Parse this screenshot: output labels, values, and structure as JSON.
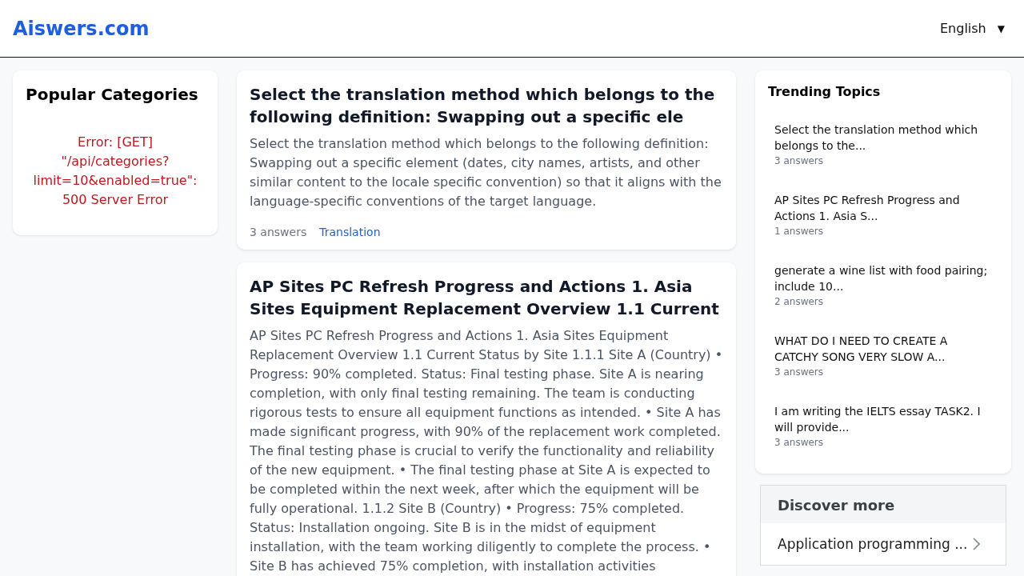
{
  "header": {
    "logo": "Aiswers.com",
    "language": {
      "label": "English",
      "caret": "▼"
    }
  },
  "popular_categories": {
    "title": "Popular Categories",
    "error": "Error: [GET] \"/api/categories?limit=10&enabled=true\": 500 Server Error"
  },
  "questions": [
    {
      "title": "Select the translation method which belongs to the following definition: Swapping out a specific ele",
      "body": "Select the translation method which belongs to the following definition: Swapping out a specific element (dates, city names, artists, and other similar content to the locale specific convention) so that it aligns with the language-specific conventions of the target language.",
      "answers": "3 answers",
      "tag": "Translation"
    },
    {
      "title": "AP Sites PC Refresh Progress and Actions 1. Asia Sites Equipment Replacement Overview 1.1 Current",
      "body": "AP Sites PC Refresh Progress and Actions 1. Asia Sites Equipment Replacement Overview 1.1 Current Status by Site 1.1.1 Site A (Country) • Progress: 90% completed. Status: Final testing phase. Site A is nearing completion, with only final testing remaining. The team is conducting rigorous tests to ensure all equipment functions as intended. • Site A has made significant progress, with 90% of the replacement work completed. The final testing phase is crucial to verify the functionality and reliability of the new equipment. • The final testing phase at Site A is expected to be completed within the next week, after which the equipment will be fully operational. 1.1.2 Site B (Country) • Progress: 75% completed. Status: Installation ongoing. Site B is in the midst of equipment installation, with the team working diligently to complete the process. • Site B has achieved 75% completion, with installation activities"
    }
  ],
  "trending": {
    "title": "Trending Topics",
    "items": [
      {
        "text": "Select the translation method which belongs to the...",
        "answers": "3 answers"
      },
      {
        "text": "AP Sites PC Refresh Progress and Actions 1. Asia S...",
        "answers": "1 answers"
      },
      {
        "text": "generate a wine list with food pairing; include 10...",
        "answers": "2 answers"
      },
      {
        "text": "WHAT DO I NEED TO CREATE A CATCHY SONG VERY SLOW A...",
        "answers": "3 answers"
      },
      {
        "text": "I am writing the IELTS essay TASK2. I will provide...",
        "answers": "3 answers"
      }
    ]
  },
  "discover_more": {
    "title": "Discover more",
    "items": [
      "Application programming ..."
    ]
  }
}
